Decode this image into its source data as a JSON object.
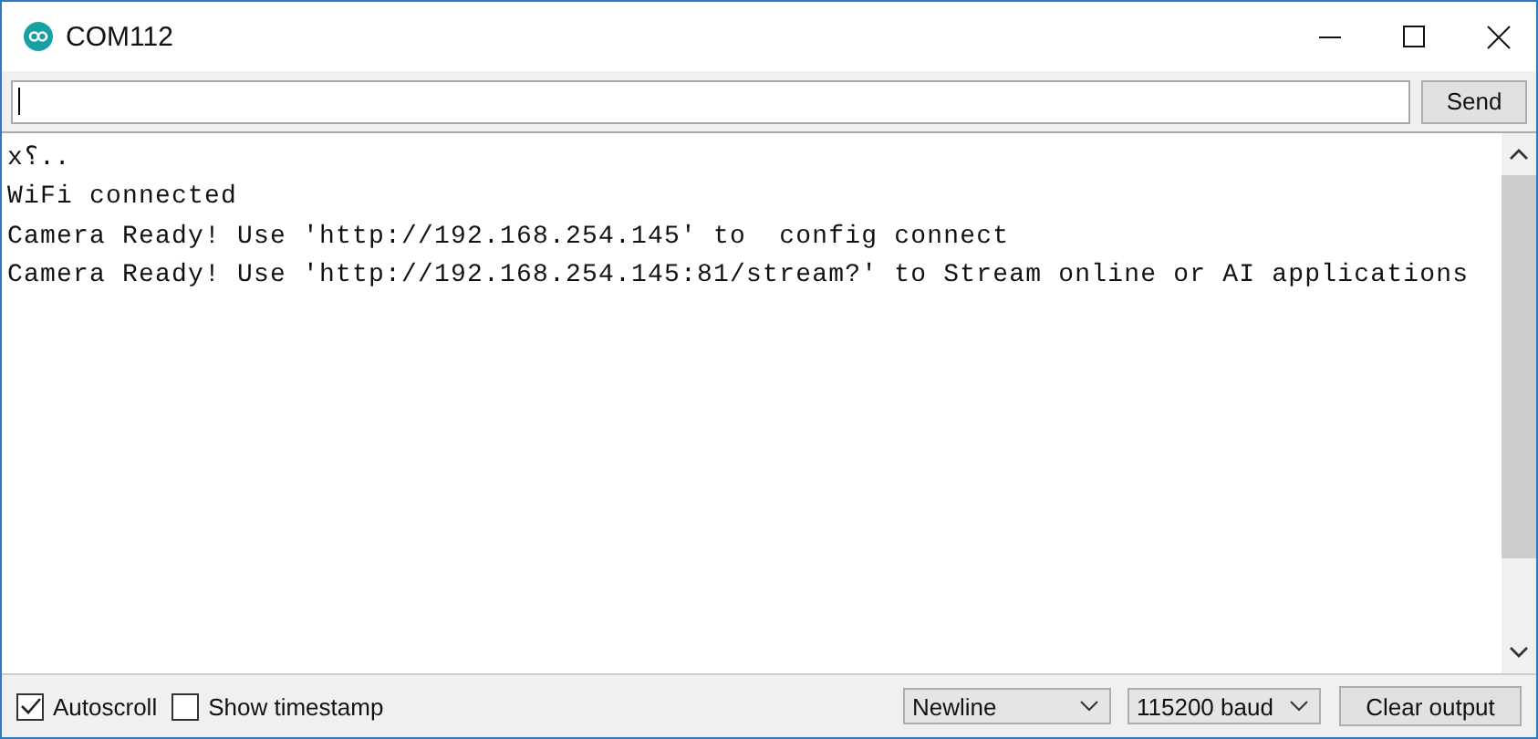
{
  "window": {
    "title": "COM112"
  },
  "send_bar": {
    "button": "Send"
  },
  "output": {
    "lines": [
      "x؟..",
      "WiFi connected",
      "Camera Ready! Use 'http://192.168.254.145' to  config connect",
      "Camera Ready! Use 'http://192.168.254.145:81/stream?' to Stream online or AI applications"
    ]
  },
  "footer": {
    "options": [
      {
        "label": "Autoscroll",
        "checked": true
      },
      {
        "label": "Show timestamp",
        "checked": false
      }
    ],
    "line_ending": "Newline",
    "baud_rate": "115200 baud",
    "clear_button": "Clear output"
  }
}
